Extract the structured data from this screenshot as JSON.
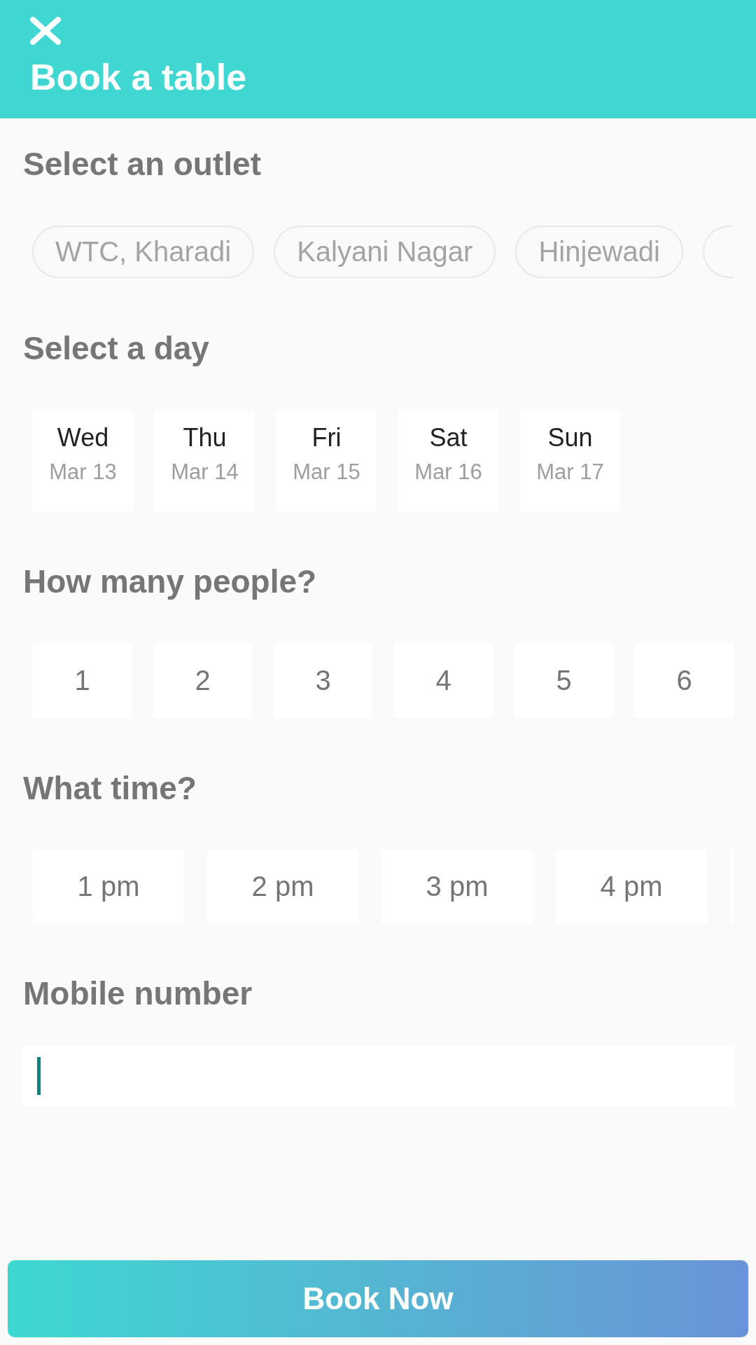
{
  "header": {
    "title": "Book a table"
  },
  "outlet_section": {
    "heading": "Select an outlet",
    "outlets": [
      {
        "label": "WTC, Kharadi",
        "selected": false
      },
      {
        "label": "Kalyani Nagar",
        "selected": false
      },
      {
        "label": "Hinjewadi",
        "selected": false
      },
      {
        "selected": false
      }
    ]
  },
  "day_section": {
    "heading": "Select a day",
    "days": [
      {
        "weekday": "Wed",
        "date": "Mar 13",
        "selected": false
      },
      {
        "weekday": "Thu",
        "date": "Mar 14",
        "selected": false
      },
      {
        "weekday": "Fri",
        "date": "Mar 15",
        "selected": false
      },
      {
        "weekday": "Sat",
        "date": "Mar 16",
        "selected": false
      },
      {
        "weekday": "Sun",
        "date": "Mar 17",
        "selected": false
      }
    ]
  },
  "people_section": {
    "heading": "How many people?",
    "options": [
      {
        "label": "1",
        "selected": false
      },
      {
        "label": "2",
        "selected": false
      },
      {
        "label": "3",
        "selected": false
      },
      {
        "label": "4",
        "selected": false
      },
      {
        "label": "5",
        "selected": false
      },
      {
        "label": "6",
        "selected": false
      }
    ]
  },
  "time_section": {
    "heading": "What time?",
    "slots": [
      {
        "label": "1 pm",
        "selected": false
      },
      {
        "label": "2 pm",
        "selected": false
      },
      {
        "label": "3 pm",
        "selected": false
      },
      {
        "label": "4 pm",
        "selected": false
      },
      {
        "selected": false
      }
    ]
  },
  "mobile_section": {
    "heading": "Mobile number",
    "field": {
      "focused": true
    }
  },
  "book_button": {
    "label": "Book Now"
  }
}
